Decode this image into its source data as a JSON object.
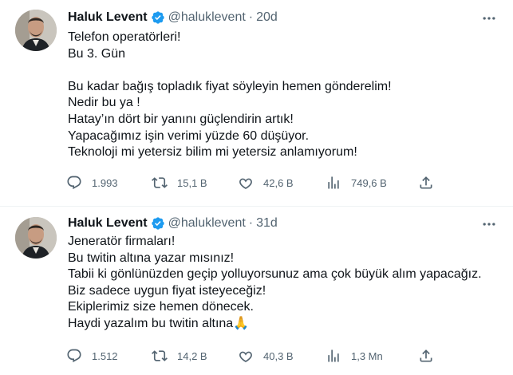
{
  "tweets": [
    {
      "author": {
        "name": "Haluk Levent",
        "handle": "@haluklevent",
        "separator": "·",
        "time": "20d",
        "verified": true
      },
      "lines": [
        "Telefon operatörleri!",
        "Bu 3. Gün",
        "",
        "Bu kadar bağış topladık fiyat söyleyin hemen gönderelim!",
        "Nedir bu ya !",
        "Hatay’ın dört bir yanını güçlendirin artık!",
        "Yapacağımız işin verimi yüzde 60 düşüyor.",
        "Teknoloji mi yetersiz bilim mi yetersiz anlamıyorum!"
      ],
      "stats": {
        "replies": "1.993",
        "retweets": "15,1 B",
        "likes": "42,6 B",
        "views": "749,6 B"
      }
    },
    {
      "author": {
        "name": "Haluk Levent",
        "handle": "@haluklevent",
        "separator": "·",
        "time": "31d",
        "verified": true
      },
      "lines": [
        "Jeneratör firmaları!",
        "Bu twitin altına yazar mısınız!",
        "Tabii ki gönlünüzden geçip yolluyorsunuz ama çok büyük alım yapacağız.",
        "Biz sadece uygun fiyat isteyeceğiz!",
        "Ekiplerimiz size hemen dönecek.",
        "Haydi yazalım bu twitin altına🙏"
      ],
      "stats": {
        "replies": "1.512",
        "retweets": "14,2 B",
        "likes": "40,3 B",
        "views": "1,3 Mn"
      }
    }
  ],
  "icons": {
    "verified": "verified-badge-icon",
    "more": "more-options-icon",
    "reply": "reply-icon",
    "retweet": "retweet-icon",
    "like": "heart-icon",
    "views": "views-icon",
    "share": "share-icon"
  },
  "colors": {
    "verified": "#1d9bf0",
    "muted": "#536471",
    "text": "#0f1419",
    "divider": "#eff3f4"
  }
}
